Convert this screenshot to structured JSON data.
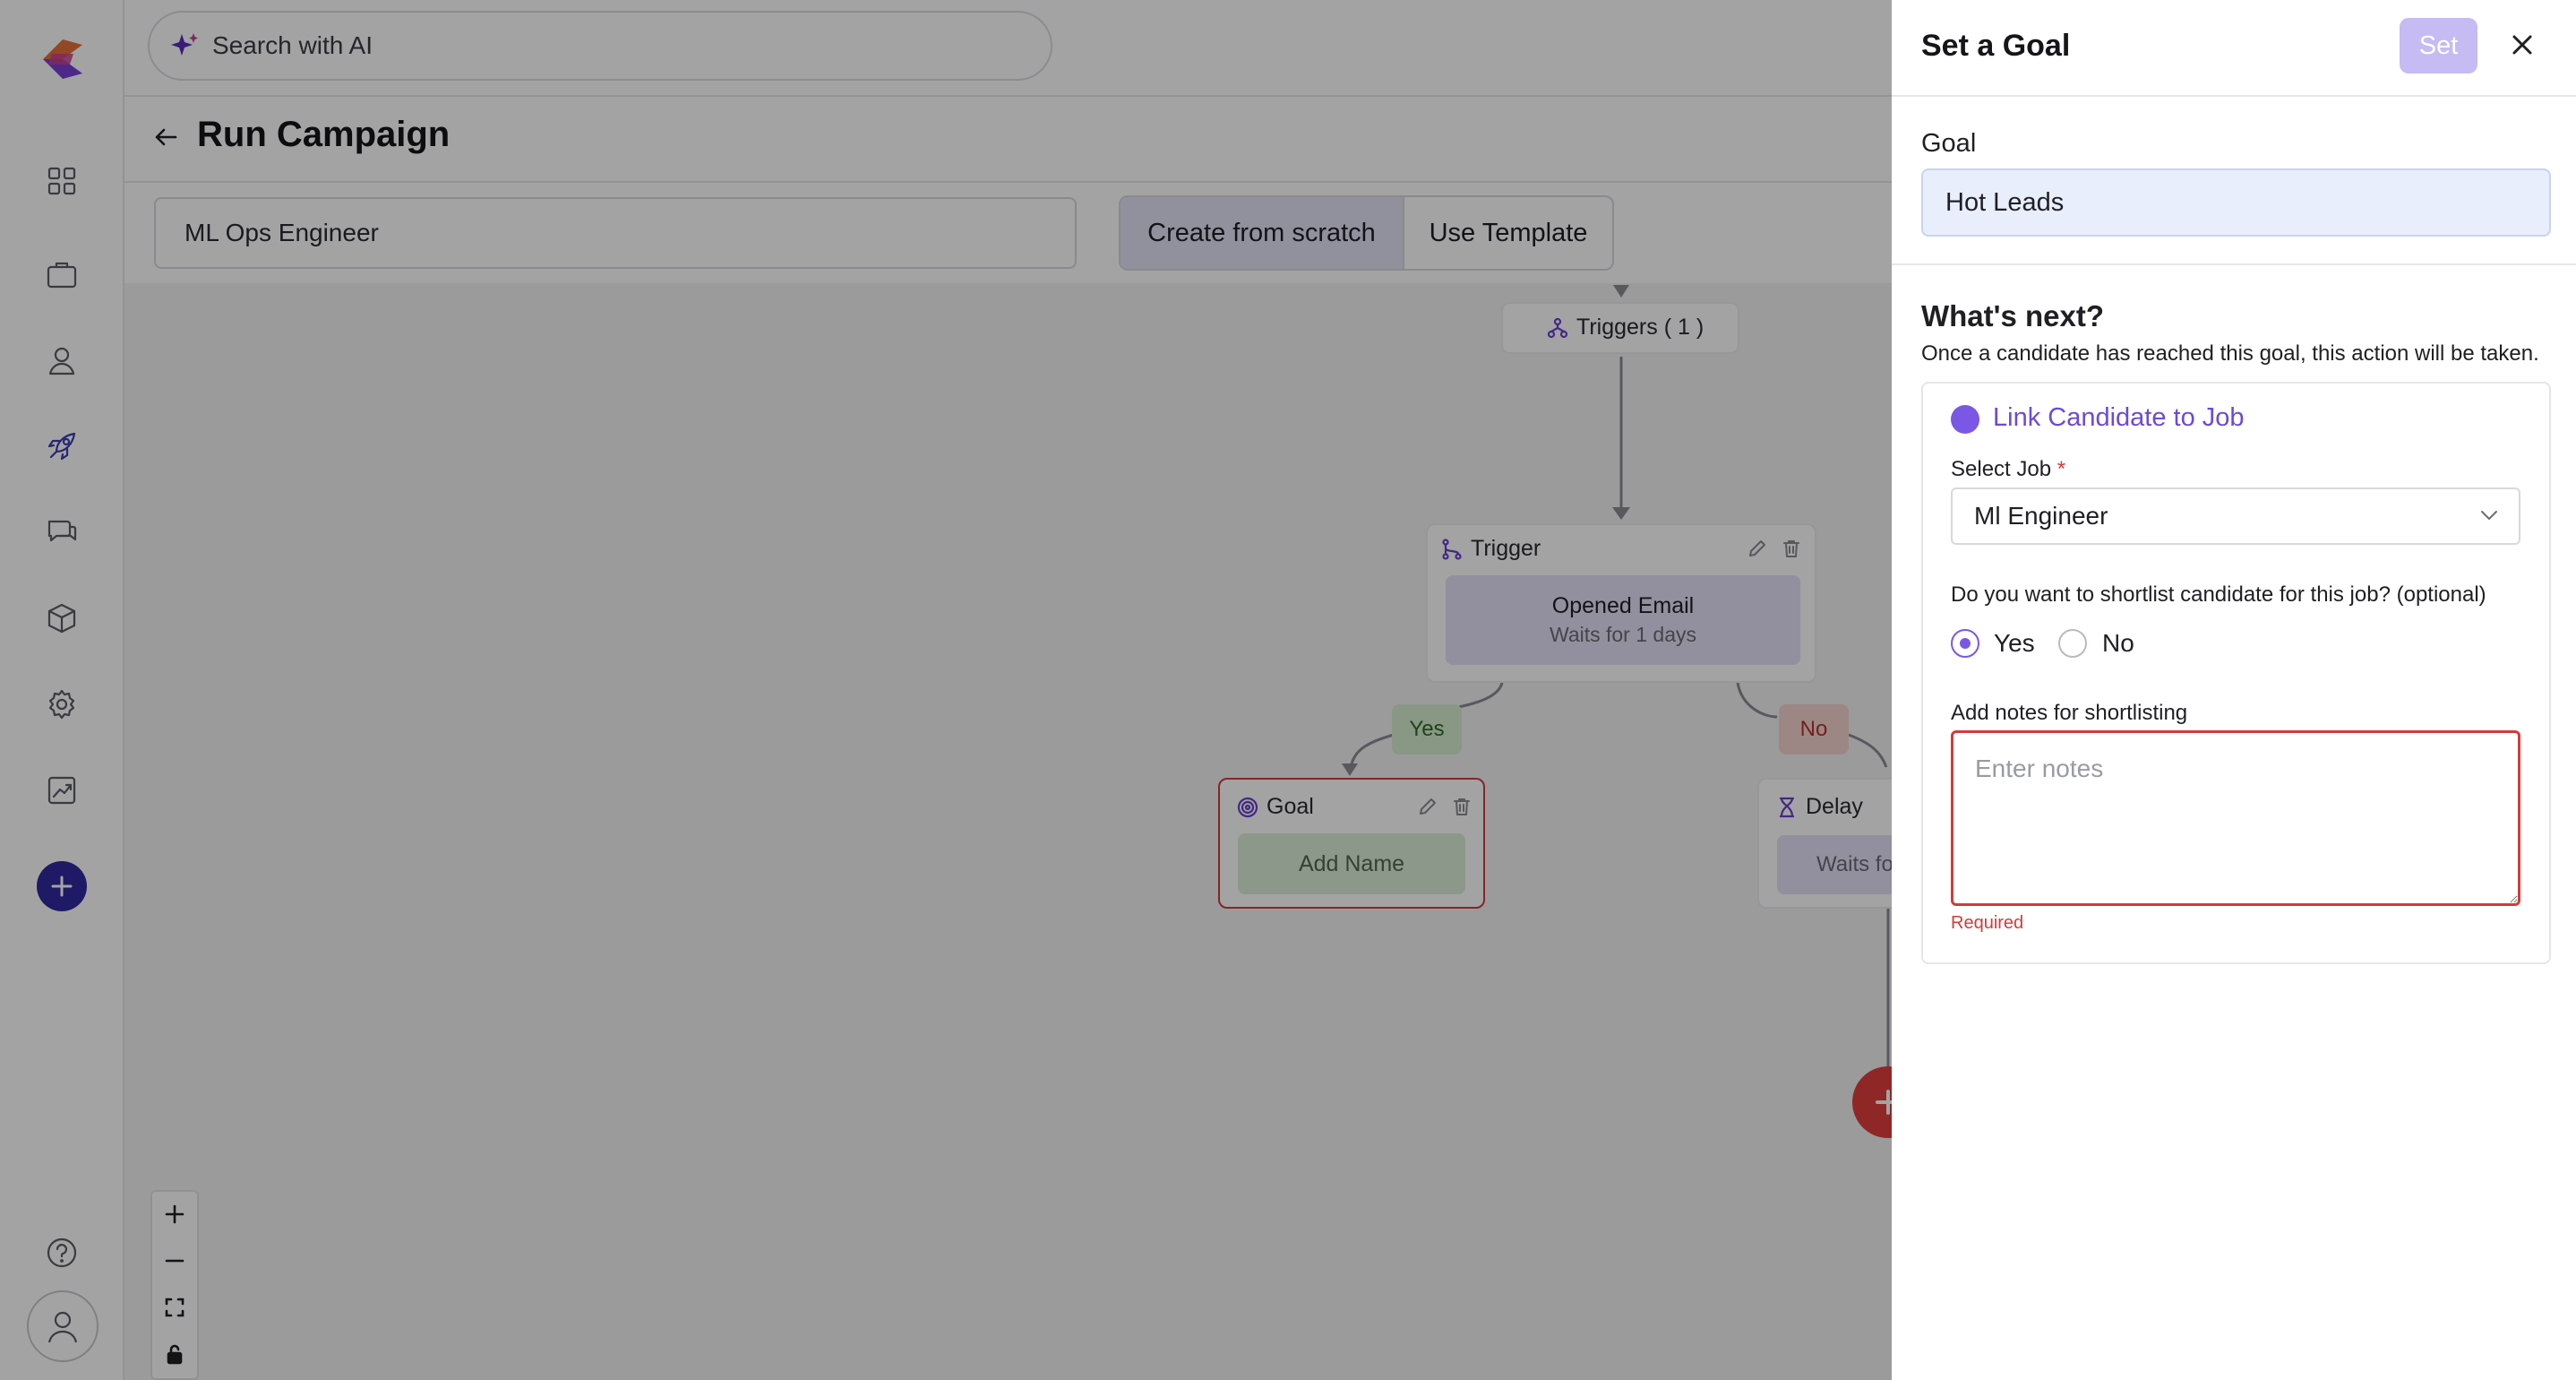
{
  "search": {
    "placeholder": "Search with AI"
  },
  "header": {
    "title": "Run Campaign"
  },
  "campaign": {
    "name_value": "ML Ops Engineer",
    "mode_options": [
      "Create from scratch",
      "Use Template"
    ],
    "selected_mode": "Create from scratch"
  },
  "sidebar": {
    "items": [
      {
        "name": "dashboard",
        "icon": "grid-icon"
      },
      {
        "name": "jobs",
        "icon": "briefcase-icon"
      },
      {
        "name": "candidates",
        "icon": "user-icon"
      },
      {
        "name": "campaigns",
        "icon": "rocket-icon",
        "active": true
      },
      {
        "name": "messages",
        "icon": "chat-icon"
      },
      {
        "name": "integrations",
        "icon": "cube-icon"
      },
      {
        "name": "settings",
        "icon": "gear-icon"
      },
      {
        "name": "analytics",
        "icon": "chart-icon"
      }
    ],
    "add_icon": "plus-icon",
    "help_icon": "help-icon",
    "avatar_icon": "user-avatar-icon"
  },
  "flow": {
    "triggers_label": "Triggers ( 1 )",
    "trigger_node": {
      "title": "Trigger",
      "event": "Opened Email",
      "wait": "Waits for 1 days"
    },
    "branch_yes": "Yes",
    "branch_no": "No",
    "goal_node": {
      "title": "Goal",
      "placeholder": "Add Name"
    },
    "delay_node": {
      "title": "Delay",
      "wait": "Waits fo"
    }
  },
  "panel": {
    "title": "Set a Goal",
    "set_label": "Set",
    "goal_label": "Goal",
    "goal_value": "Hot Leads",
    "next_title": "What's next?",
    "next_subtitle": "Once a candidate has reached this goal, this action will be taken.",
    "action_label": "Link Candidate to Job",
    "select_job_label": "Select Job",
    "required_mark": "*",
    "select_job_value": "Ml Engineer",
    "shortlist_question": "Do you want to shortlist candidate for this job? (optional)",
    "shortlist_options": [
      "Yes",
      "No"
    ],
    "shortlist_selected": "Yes",
    "notes_label": "Add notes for shortlisting",
    "notes_placeholder": "Enter notes",
    "notes_error": "Required"
  },
  "colors": {
    "accent": "#7b57e6",
    "brand_dark": "#2f2a9e",
    "error": "#d23b3b",
    "goal_field_bg": "#e8eefc"
  }
}
